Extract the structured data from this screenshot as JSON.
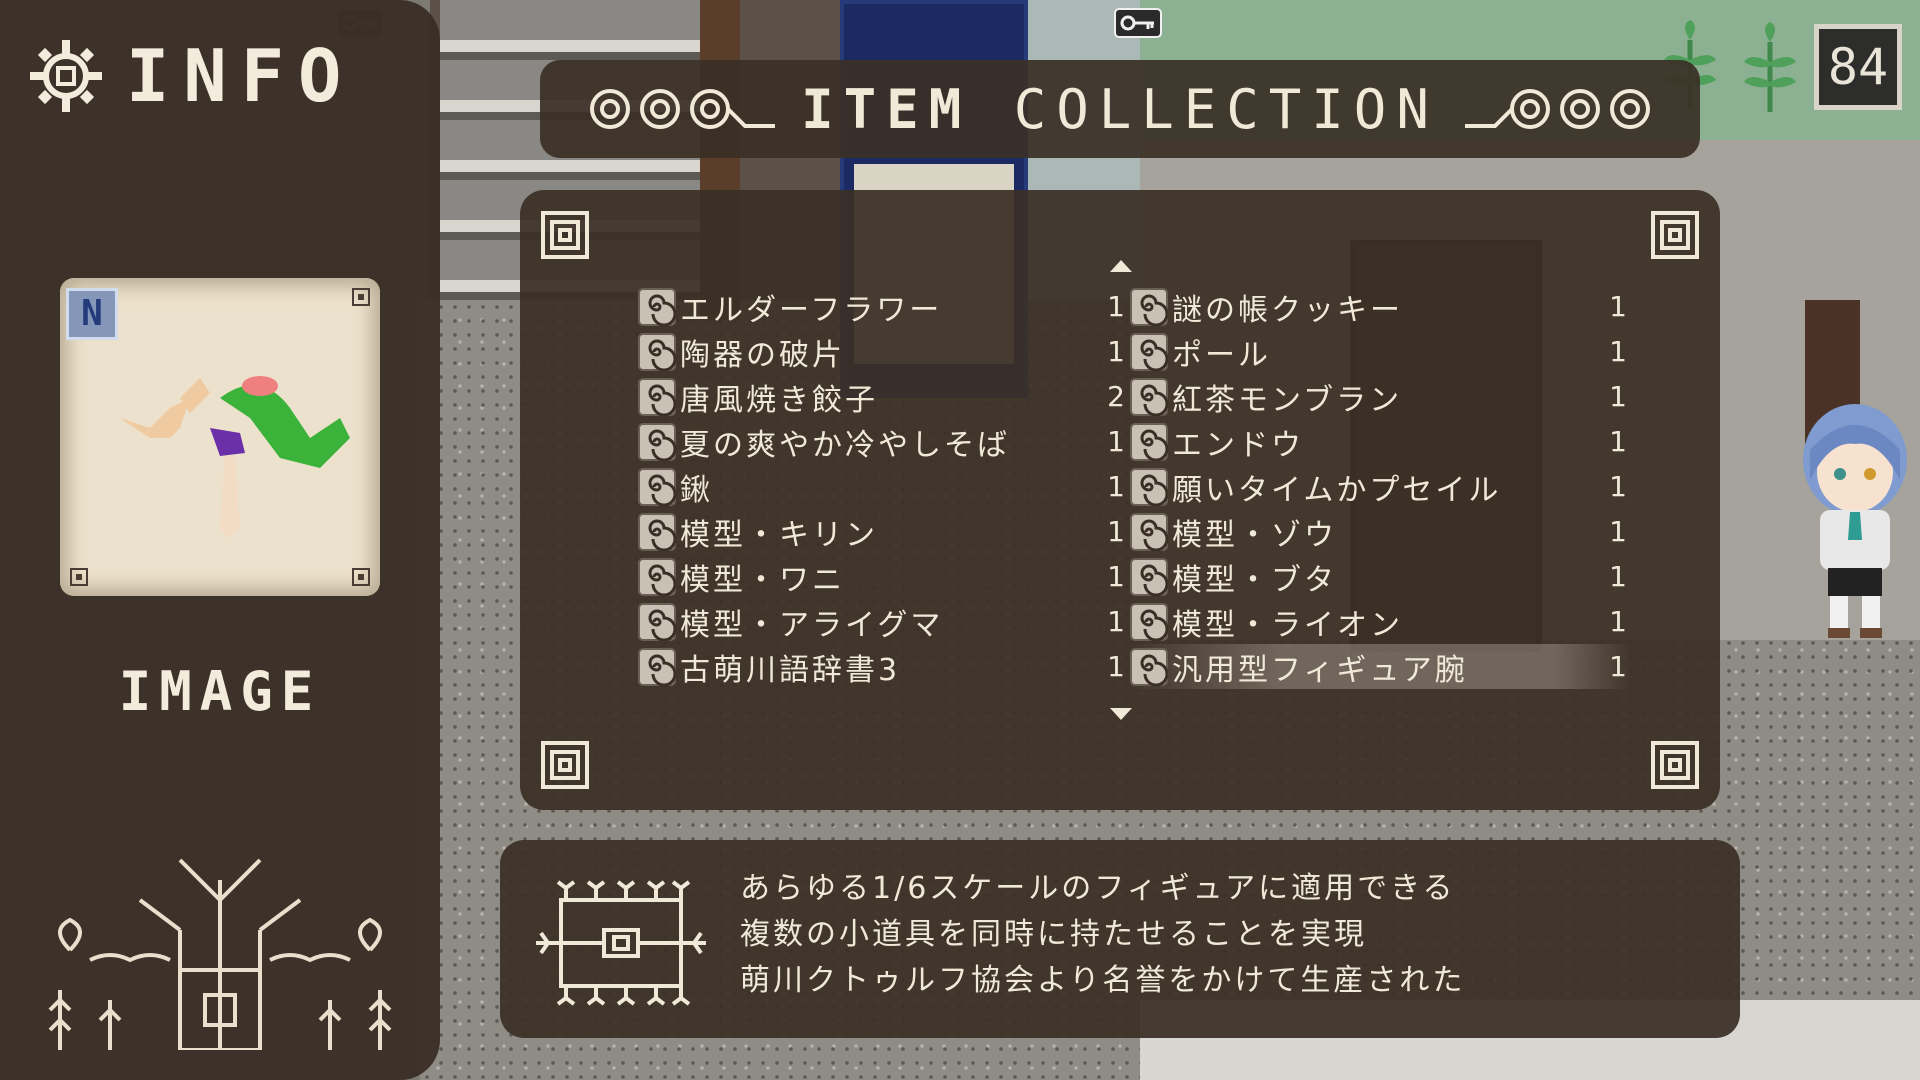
{
  "info_panel": {
    "title": "INFO",
    "image_label": "IMAGE",
    "preview_badge": "N"
  },
  "collection": {
    "title_bold": "ITEM",
    "title_rest": "COLLECTION",
    "left_items": [
      {
        "name": "エルダーフラワー",
        "count": "1"
      },
      {
        "name": "陶器の破片",
        "count": "1"
      },
      {
        "name": "唐風焼き餃子",
        "count": "2"
      },
      {
        "name": "夏の爽やか冷やしそば",
        "count": "1"
      },
      {
        "name": "鍬",
        "count": "1"
      },
      {
        "name": "模型・キリン",
        "count": "1"
      },
      {
        "name": "模型・ワニ",
        "count": "1"
      },
      {
        "name": "模型・アライグマ",
        "count": "1"
      },
      {
        "name": "古萌川語辞書3",
        "count": "1"
      }
    ],
    "right_items": [
      {
        "name": "謎の帳クッキー",
        "count": "1"
      },
      {
        "name": "ポール",
        "count": "1"
      },
      {
        "name": "紅茶モンブラン",
        "count": "1"
      },
      {
        "name": "エンドウ",
        "count": "1"
      },
      {
        "name": "願いタイムかプセイル",
        "count": "1"
      },
      {
        "name": "模型・ゾウ",
        "count": "1"
      },
      {
        "name": "模型・ブタ",
        "count": "1"
      },
      {
        "name": "模型・ライオン",
        "count": "1"
      },
      {
        "name": "汎用型フィギュア腕",
        "count": "1"
      }
    ],
    "selected_item": "汎用型フィギュア腕"
  },
  "description": {
    "lines": [
      "あらゆる1/6スケールのフィギュアに適用できる",
      "複数の小道具を同時に持たせることを実現",
      "萌川クトゥルフ協会より名誉をかけて生産された"
    ]
  },
  "hud": {
    "counter": "84"
  },
  "colors": {
    "panel": "#3a2f26",
    "text": "#f1e9d8",
    "wall_green": "#8cb092"
  }
}
